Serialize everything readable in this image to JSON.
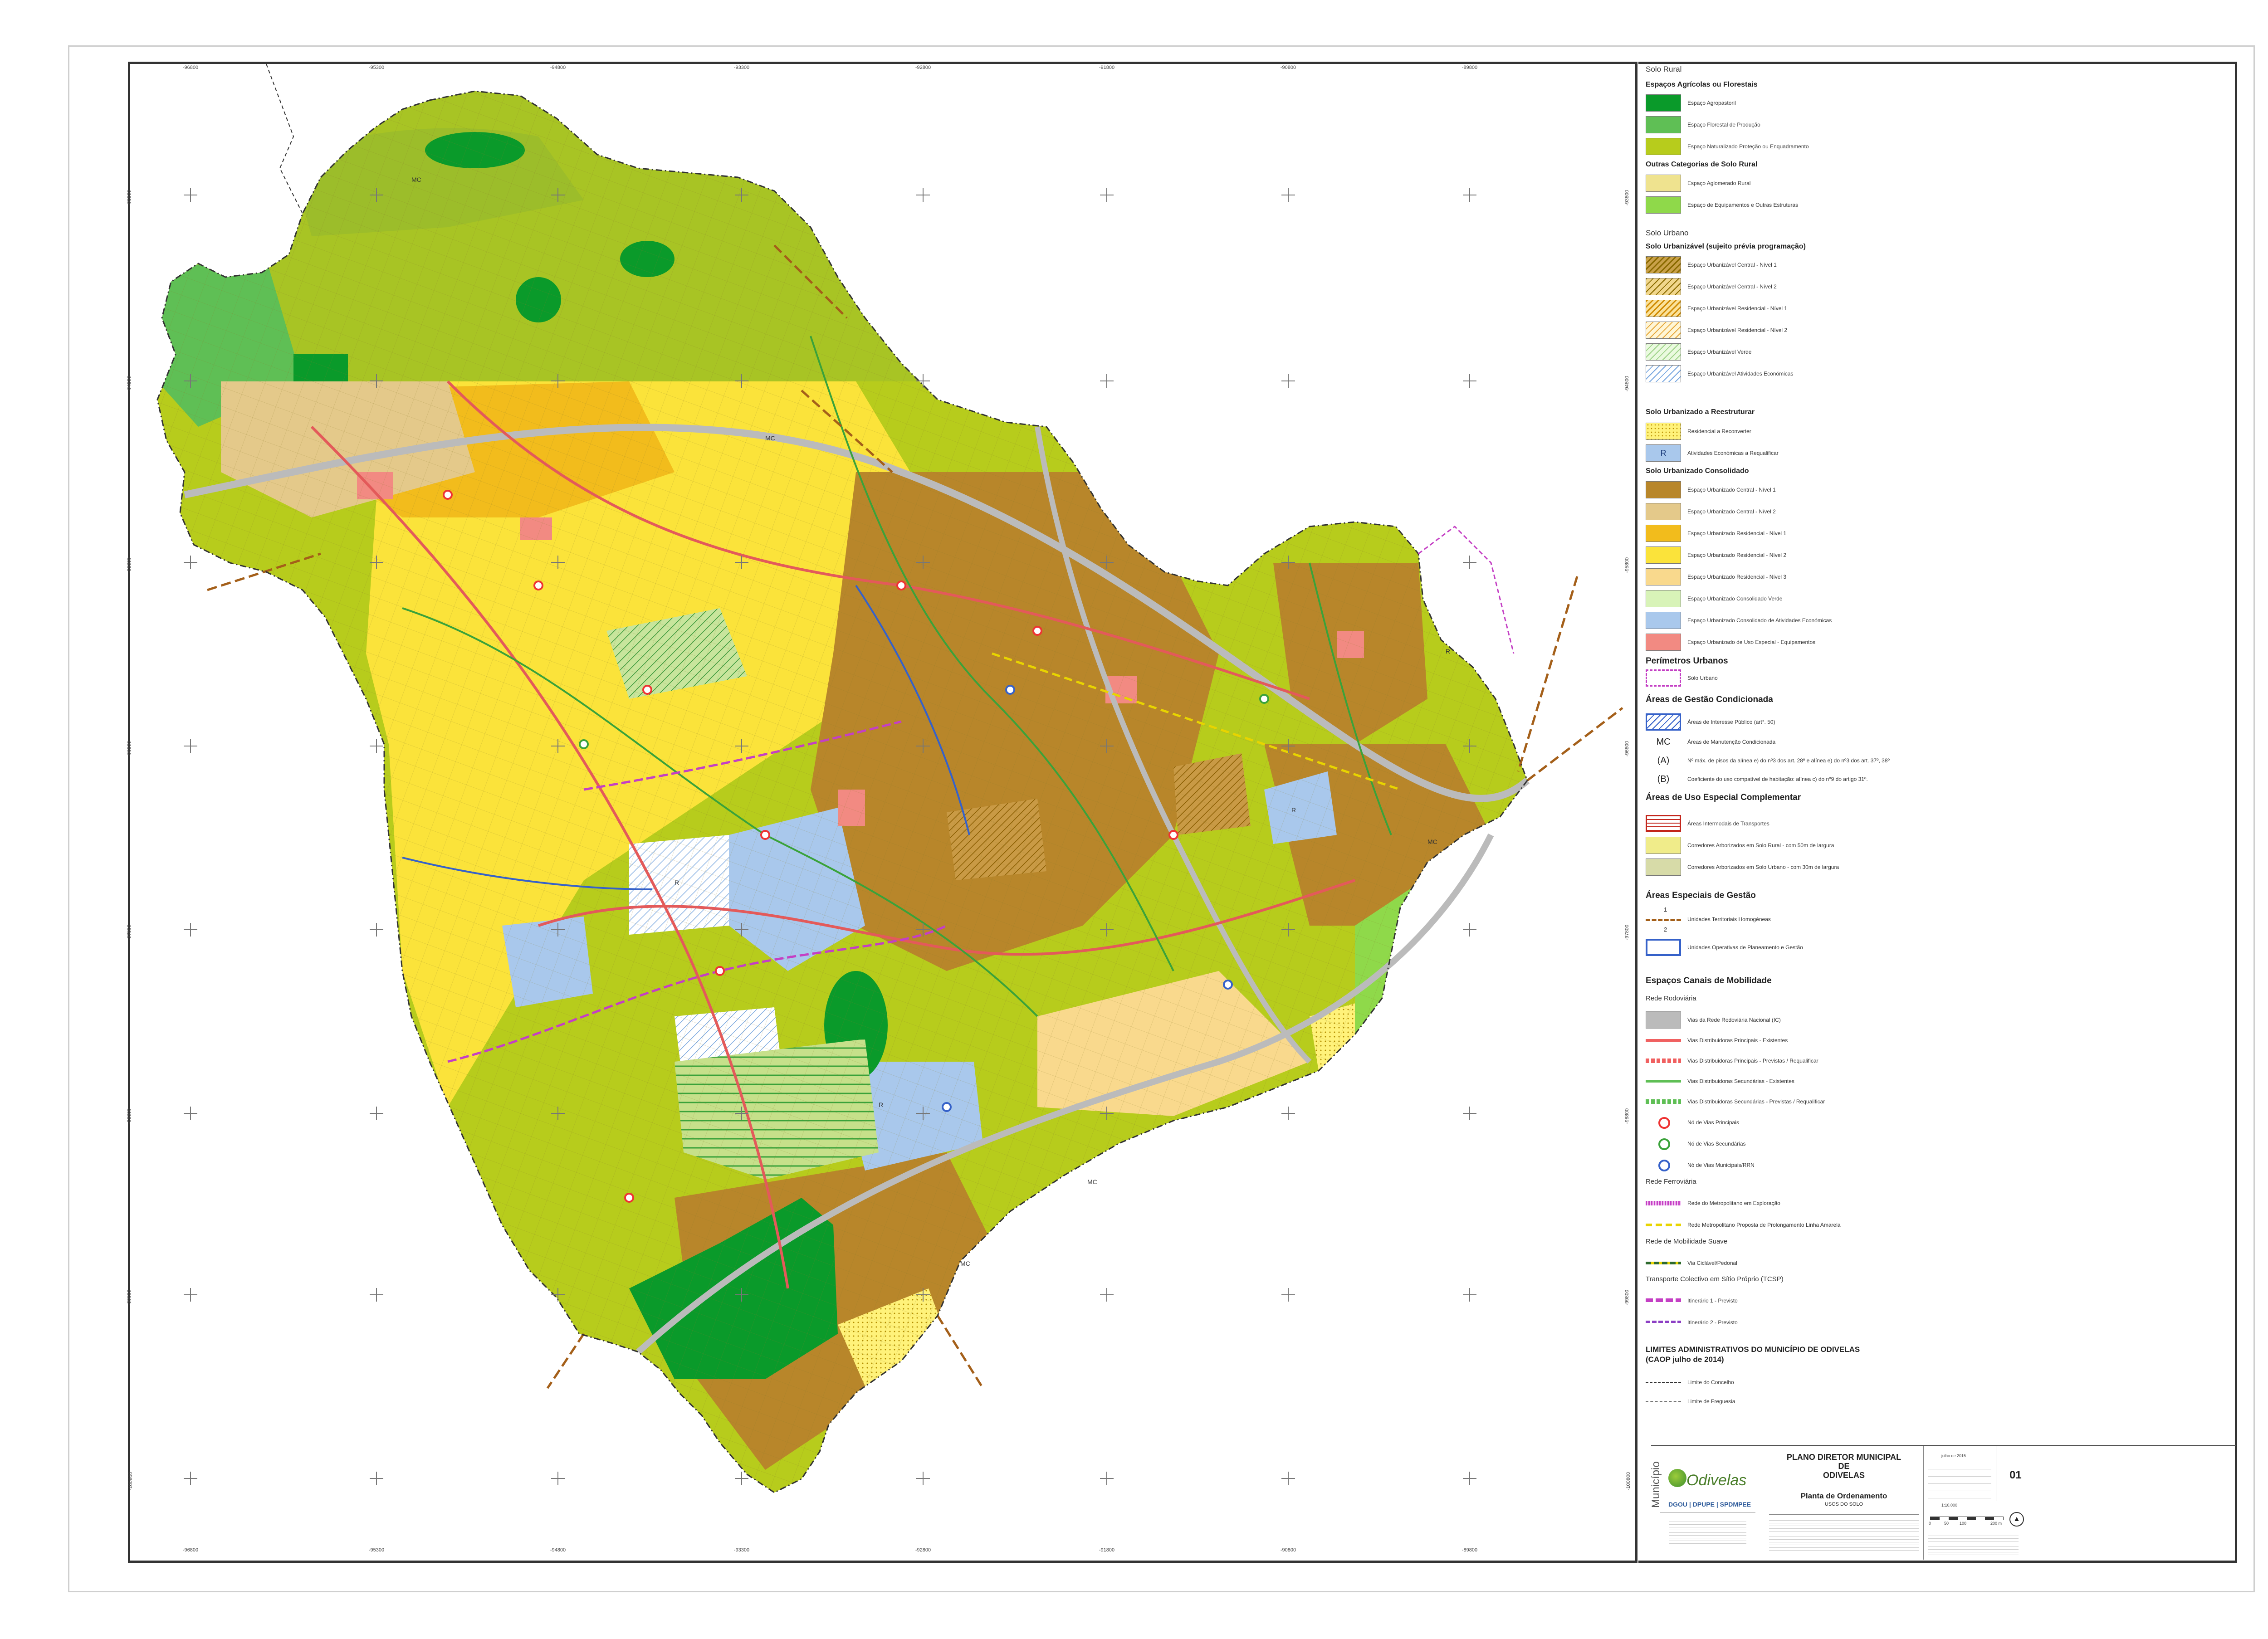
{
  "coordinates": {
    "top": [
      "-96800",
      "-95300",
      "-94800",
      "-93300",
      "-92800",
      "-91800",
      "-90800",
      "-89800"
    ],
    "bottom": [
      "-96800",
      "-95300",
      "-94800",
      "-93300",
      "-92800",
      "-91800",
      "-90800",
      "-89800"
    ],
    "left": [
      "-93800",
      "-94800",
      "-95800",
      "-96800",
      "-97800",
      "-98800",
      "-99800",
      "-100800"
    ],
    "right": [
      "-93800",
      "-94800",
      "-95800",
      "-96800",
      "-97800",
      "-98800",
      "-99800",
      "-100800"
    ]
  },
  "map_labels": {
    "mc": "MC",
    "r": "R"
  },
  "legend": {
    "solo_rural": {
      "heading": "Solo Rural",
      "group1_title": "Espaços Agrícolas ou Florestais",
      "items1": [
        {
          "label": "Espaço Agropastoril",
          "color": "#0a9a2a"
        },
        {
          "label": "Espaço Florestal de Produção",
          "color": "#5fbf55"
        },
        {
          "label": "Espaço Naturalizado Proteção ou Enquadramento",
          "color": "#b7cc1c"
        }
      ],
      "group2_title": "Outras Categorias de Solo Rural",
      "items2": [
        {
          "label": "Espaço Aglomerado Rural",
          "color": "#efe38f"
        },
        {
          "label": "Espaço de Equipamentos e Outras Estruturas",
          "color": "#8fd94a"
        }
      ]
    },
    "solo_urbano": {
      "heading": "Solo Urbano",
      "group1_title": "Solo Urbanizável (sujeito prévia programação)",
      "items1": [
        {
          "label": "Espaço Urbanizável Central - Nível 1",
          "style": "hatch-a"
        },
        {
          "label": "Espaço Urbanizável Central - Nível 2",
          "style": "hatch-b"
        },
        {
          "label": "Espaço Urbanizável Residencial - Nível 1",
          "style": "hatch-c"
        },
        {
          "label": "Espaço Urbanizável Residencial - Nível 2",
          "style": "hatch-d"
        },
        {
          "label": "Espaço Urbanizável Verde",
          "style": "hatch-e"
        },
        {
          "label": "Espaço Urbanizável Atividades Económicas",
          "style": "hatch-f"
        }
      ],
      "group2_title": "Solo Urbanizado a Reestruturar",
      "items2": [
        {
          "label": "Residencial a Reconverter",
          "style": "dots"
        },
        {
          "label": "Atividades Económicas a Requalificar",
          "color": "#a9c8ec",
          "letter": "R"
        }
      ],
      "group3_title": "Solo Urbanizado Consolidado",
      "items3": [
        {
          "label": "Espaço Urbanizado Central - Nível 1",
          "color": "#b8862a"
        },
        {
          "label": "Espaço Urbanizado Central - Nível 2",
          "color": "#e4c98a"
        },
        {
          "label": "Espaço Urbanizado Residencial - Nível 1",
          "color": "#f2bc1c"
        },
        {
          "label": "Espaço Urbanizado Residencial - Nível 2",
          "color": "#fbe33a"
        },
        {
          "label": "Espaço Urbanizado Residencial - Nível 3",
          "color": "#f9d98d"
        },
        {
          "label": "Espaço Urbanizado Consolidado Verde",
          "color": "#d8f3b8"
        },
        {
          "label": "Espaço Urbanizado Consolidado de Atividades Económicas",
          "color": "#a9c8ec"
        },
        {
          "label": "Espaço Urbanizado de Uso Especial - Equipamentos",
          "color": "#f28a82"
        }
      ]
    },
    "perimetros": {
      "title": "Perímetros Urbanos",
      "item": "Solo Urbano"
    },
    "gestao_condicionada": {
      "title": "Áreas de Gestão Condicionada",
      "items": [
        {
          "symbol": "",
          "label": "Áreas de Interesse Público (art°. 50)"
        },
        {
          "symbol": "MC",
          "label": "Áreas de Manutenção Condicionada"
        },
        {
          "symbol": "(A)",
          "label": "Nº máx. de pisos da alínea e) do nº3 dos art. 28º e alínea e) do nº3 dos art. 37º, 38º"
        },
        {
          "symbol": "(B)",
          "label": "Coeficiente do uso compatível de habitação: alínea c) do nº9 do artigo 31º."
        }
      ]
    },
    "uso_especial": {
      "title": "Áreas de Uso Especial Complementar",
      "items": [
        {
          "label": "Áreas Intermodais de Transportes"
        },
        {
          "label": "Corredores Arborizados em Solo Rural - com 50m de largura",
          "color": "#f0ec8a"
        },
        {
          "label": "Corredores Arborizados em Solo Urbano - com 30m de largura",
          "color": "#d7dba8"
        }
      ]
    },
    "areas_especiais": {
      "title": "Áreas Especiais de Gestão",
      "num1": "1",
      "num2": "2",
      "items": [
        {
          "label": "Unidades Territoriais Homogéneas"
        },
        {
          "label": "Unidades Operativas de Planeamento e Gestão"
        }
      ]
    },
    "mobilidade": {
      "title": "Espaços Canais de Mobilidade",
      "rodoviaria": "Rede Rodoviária",
      "rod_items": [
        {
          "label": "Vias da Rede Rodoviária Nacional (IC)"
        },
        {
          "label": "Vias Distribuidoras Principais - Existentes"
        },
        {
          "label": "Vias Distribuidoras Principais - Previstas / Requalificar"
        },
        {
          "label": "Vias Distribuidoras Secundárias - Existentes"
        },
        {
          "label": "Vias Distribuidoras Secundárias - Previstas / Requalificar"
        },
        {
          "label": "Nó de Vias Principais"
        },
        {
          "label": "Nó de Vias Secundárias"
        },
        {
          "label": "Nó de Vias Municipais/RRN"
        }
      ],
      "ferroviaria": "Rede Ferroviária",
      "ferr_items": [
        {
          "label": "Rede do Metropolitano em Exploração"
        },
        {
          "label": "Rede Metropolitano Proposta de Prolongamento Linha Amarela"
        }
      ],
      "suave": "Rede de Mobilidade Suave",
      "suave_items": [
        {
          "label": "Via Ciclável/Pedonal"
        }
      ],
      "tcsp": "Transporte Colectivo em Sítio Próprio (TCSP)",
      "tcsp_items": [
        {
          "label": "Itinerário 1 - Previsto"
        },
        {
          "label": "Itinerário 2 - Previsto"
        }
      ]
    },
    "limites": {
      "title": "LIMITES ADMINISTRATIVOS DO MUNICÍPIO DE ODIVELAS",
      "subtitle": "(CAOP julho de 2014)",
      "items": [
        {
          "label": "Limite do Concelho"
        },
        {
          "label": "Limite de Freguesia"
        }
      ]
    }
  },
  "title_block": {
    "municipio": "Município",
    "brand": "Odivelas",
    "dept": "DGOU | DPUPE | SPDMPEE",
    "title_line1": "PLANO DIRETOR MUNICIPAL",
    "title_line2": "DE",
    "title_line3": "ODIVELAS",
    "planta": "Planta de Ordenamento",
    "planta_sub": "USOS DO SOLO",
    "date": "julho de 2015",
    "sheet": "01",
    "scale": "1:10.000",
    "scale_ticks": [
      "0",
      "50",
      "100",
      "200 m"
    ]
  }
}
